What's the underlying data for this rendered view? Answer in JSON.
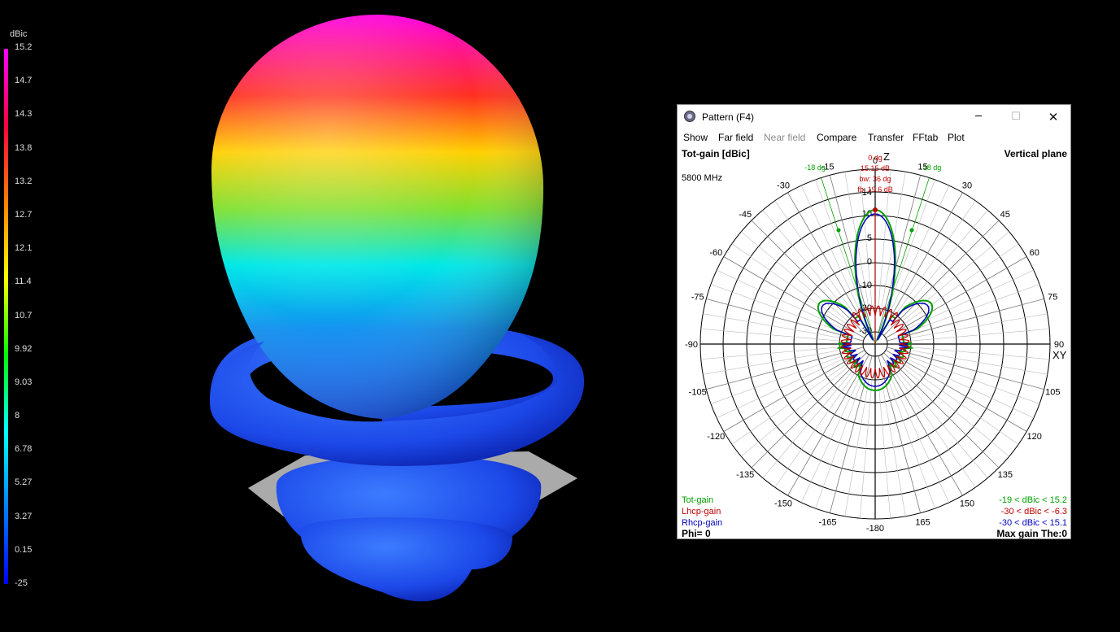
{
  "legend": {
    "unit": "dBic",
    "ticks": [
      "15.2",
      "14.7",
      "14.3",
      "13.8",
      "13.2",
      "12.7",
      "12.1",
      "11.4",
      "10.7",
      "9.92",
      "9.03",
      "8",
      "6.78",
      "5.27",
      "3.27",
      "0.15",
      "-25"
    ],
    "colors": [
      "#ff00ff",
      "#ff0040",
      "#ff8000",
      "#ffff00",
      "#00ff00",
      "#00ffff",
      "#0080ff",
      "#0000ff"
    ]
  },
  "window": {
    "title": "Pattern   (F4)",
    "controls": {
      "minimize": "─",
      "maximize": "☐",
      "close": "✕"
    },
    "menu": [
      {
        "label": "Show",
        "enabled": true
      },
      {
        "label": "Far field",
        "enabled": true
      },
      {
        "label": "Near field",
        "enabled": false
      },
      {
        "label": "Compare",
        "enabled": true
      },
      {
        "label": "Transfer",
        "enabled": true
      },
      {
        "label": "FFtab",
        "enabled": true
      },
      {
        "label": "Plot",
        "enabled": true
      }
    ]
  },
  "plot": {
    "title": "Tot-gain [dBic]",
    "plane": "Vertical plane",
    "frequency": "5800 MHz",
    "z_label": "Z",
    "xy_label": "XY",
    "angle_labels": [
      "0",
      "15",
      "30",
      "45",
      "60",
      "75",
      "90",
      "105",
      "120",
      "135",
      "150",
      "165",
      "-180",
      "-165",
      "-150",
      "-135",
      "-120",
      "-105",
      "-90",
      "-75",
      "-60",
      "-45",
      "-30",
      "-15"
    ],
    "ring_labels": [
      "14",
      "10",
      "5",
      "0",
      "-10",
      "-20",
      "-30"
    ],
    "beam_markers": {
      "left": "-18 dg",
      "right": "18 dg"
    },
    "info": [
      "0 dg",
      "15.15 dB",
      "bw: 36 dg",
      "fb: 19.6 dB"
    ],
    "phi": "Phi= 0",
    "max_gain": "Max gain The:0",
    "series": [
      {
        "name": "Tot-gain",
        "range": "-19 < dBic < 15.2",
        "color": "#00a000"
      },
      {
        "name": "Lhcp-gain",
        "range": "-30 < dBic < -6.3",
        "color": "#c00000"
      },
      {
        "name": "Rhcp-gain",
        "range": "-30 < dBic < 15.1",
        "color": "#0000c0"
      }
    ]
  }
}
